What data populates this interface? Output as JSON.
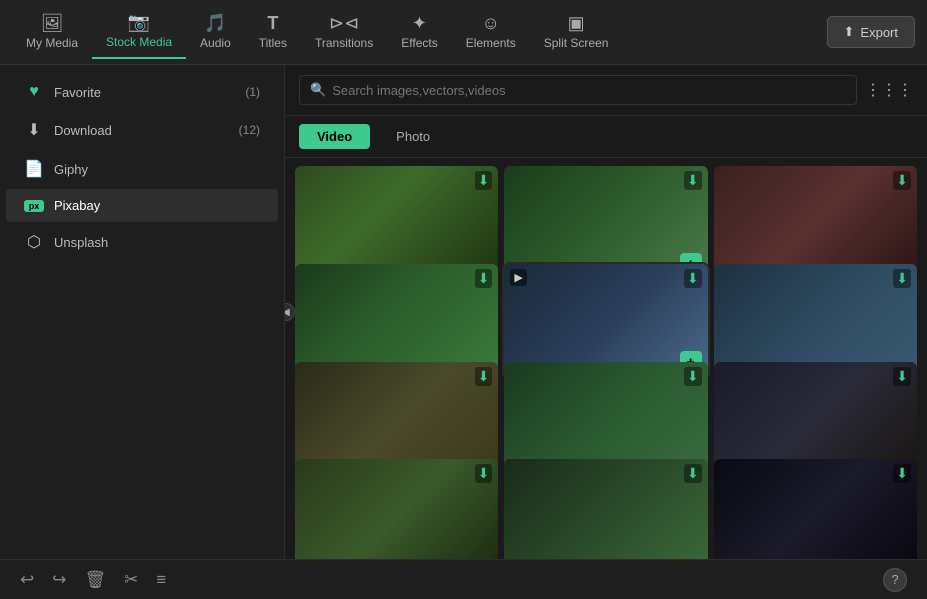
{
  "nav": {
    "items": [
      {
        "id": "my-media",
        "label": "My Media",
        "icon": "🖼",
        "active": false
      },
      {
        "id": "stock-media",
        "label": "Stock Media",
        "icon": "📷",
        "active": true
      },
      {
        "id": "audio",
        "label": "Audio",
        "icon": "🎵",
        "active": false
      },
      {
        "id": "titles",
        "label": "Titles",
        "icon": "T",
        "active": false
      },
      {
        "id": "transitions",
        "label": "Transitions",
        "icon": "⊳⊲",
        "active": false
      },
      {
        "id": "effects",
        "label": "Effects",
        "icon": "✦",
        "active": false
      },
      {
        "id": "elements",
        "label": "Elements",
        "icon": "☺",
        "active": false
      },
      {
        "id": "split-screen",
        "label": "Split Screen",
        "icon": "▣",
        "active": false
      }
    ],
    "export_label": "Export"
  },
  "sidebar": {
    "items": [
      {
        "id": "favorite",
        "label": "Favorite",
        "icon": "♥",
        "count": "(1)"
      },
      {
        "id": "download",
        "label": "Download",
        "icon": "⬇",
        "count": "(12)"
      },
      {
        "id": "giphy",
        "label": "Giphy",
        "icon": "📄",
        "count": ""
      },
      {
        "id": "pixabay",
        "label": "Pixabay",
        "icon": "PX",
        "count": "",
        "active": true
      },
      {
        "id": "unsplash",
        "label": "Unsplash",
        "icon": "⬡",
        "count": ""
      }
    ]
  },
  "search": {
    "placeholder": "Search images,vectors,videos",
    "value": ""
  },
  "tabs": [
    {
      "id": "video",
      "label": "Video",
      "active": true
    },
    {
      "id": "photo",
      "label": "Photo",
      "active": false
    }
  ],
  "media_grid": {
    "items": [
      {
        "id": 1,
        "class": "t1",
        "has_dl": true,
        "has_plus": false,
        "has_vid": false
      },
      {
        "id": 2,
        "class": "t2",
        "has_dl": true,
        "has_plus": true,
        "has_vid": false
      },
      {
        "id": 3,
        "class": "t3",
        "has_dl": true,
        "has_plus": false,
        "has_vid": false
      },
      {
        "id": 4,
        "class": "t4",
        "has_dl": true,
        "has_plus": false,
        "has_vid": false
      },
      {
        "id": 5,
        "class": "t5",
        "has_dl": true,
        "has_plus": true,
        "has_vid": true
      },
      {
        "id": 6,
        "class": "t6",
        "has_dl": true,
        "has_plus": false,
        "has_vid": false
      },
      {
        "id": 7,
        "class": "t7",
        "has_dl": true,
        "has_plus": false,
        "has_vid": false
      },
      {
        "id": 8,
        "class": "t8",
        "has_dl": true,
        "has_plus": false,
        "has_vid": false
      },
      {
        "id": 9,
        "class": "t9",
        "has_dl": true,
        "has_plus": false,
        "has_vid": false
      },
      {
        "id": 10,
        "class": "t10",
        "has_dl": true,
        "has_plus": false,
        "has_vid": false
      },
      {
        "id": 11,
        "class": "t11",
        "has_dl": true,
        "has_plus": false,
        "has_vid": false
      },
      {
        "id": 12,
        "class": "t12",
        "has_dl": true,
        "has_plus": false,
        "has_vid": false
      }
    ]
  },
  "bottom_bar": {
    "icons": [
      {
        "id": "undo",
        "symbol": "↩",
        "label": "Undo"
      },
      {
        "id": "redo",
        "symbol": "↪",
        "label": "Redo"
      },
      {
        "id": "delete",
        "symbol": "🗑",
        "label": "Delete"
      },
      {
        "id": "cut",
        "symbol": "✂",
        "label": "Cut"
      },
      {
        "id": "menu",
        "symbol": "≡",
        "label": "Menu"
      }
    ],
    "help_label": "?"
  },
  "colors": {
    "accent": "#3ec98e",
    "bg_dark": "#1a1a1a",
    "bg_mid": "#1e1e1e",
    "bg_sidebar_active": "#2e2e2e"
  }
}
